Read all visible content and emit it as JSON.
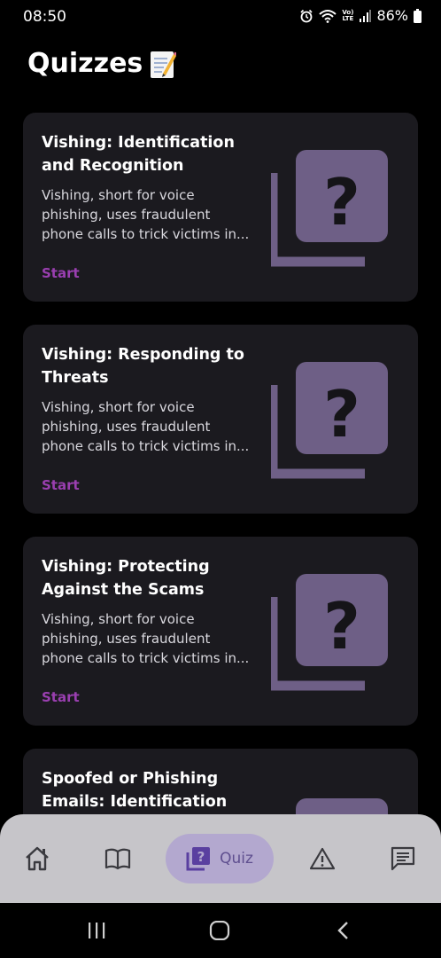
{
  "status_bar": {
    "time": "08:50",
    "volte_top": "Vo)",
    "volte_bottom": "LTE",
    "battery": "86%"
  },
  "page": {
    "title": "Quizzes"
  },
  "quizzes": [
    {
      "title": "Vishing: Identification and Recognition",
      "description": "Vishing, short for voice phishing, uses fraudulent phone calls to trick victims in...",
      "action": "Start"
    },
    {
      "title": "Vishing: Responding to Threats",
      "description": "Vishing, short for voice phishing, uses fraudulent phone calls to trick victims in...",
      "action": "Start"
    },
    {
      "title": "Vishing: Protecting Against the Scams",
      "description": "Vishing, short for voice phishing, uses fraudulent phone calls to trick victims in...",
      "action": "Start"
    },
    {
      "title": "Spoofed or Phishing Emails: Identification"
    }
  ],
  "bottom_nav": {
    "items": [
      {
        "icon": "home-icon"
      },
      {
        "icon": "book-icon"
      },
      {
        "icon": "quiz-icon",
        "label": "Quiz",
        "active": true
      },
      {
        "icon": "warning-icon"
      },
      {
        "icon": "chat-icon"
      }
    ]
  },
  "colors": {
    "background": "#000000",
    "card": "#1b1a1f",
    "accent_link": "#9a3fb0",
    "art": "#6e5f86",
    "nav_bar": "#c6c5c9",
    "nav_active_pill": "#b3a8cf"
  }
}
